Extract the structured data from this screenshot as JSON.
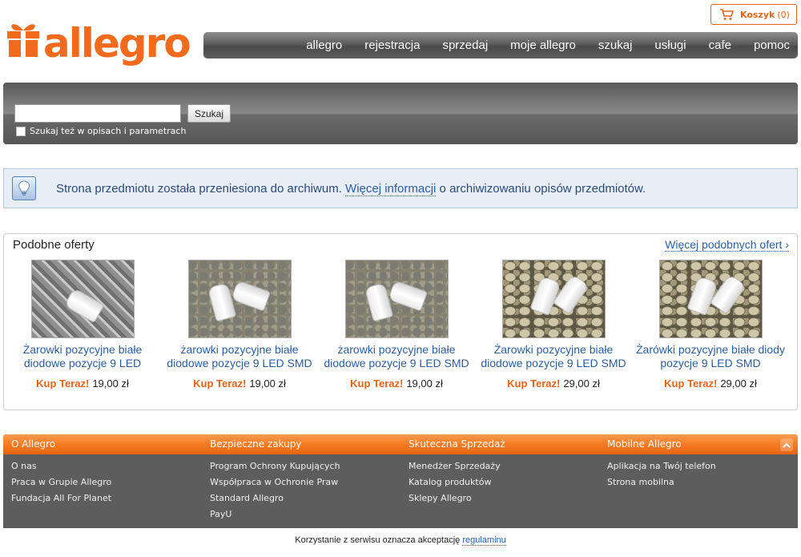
{
  "cart": {
    "label": "Koszyk",
    "count": "(0)"
  },
  "logo": {
    "text": "allegro"
  },
  "nav": {
    "items": [
      "allegro",
      "rejestracja",
      "sprzedaj",
      "moje allegro",
      "szukaj",
      "usługi",
      "cafe",
      "pomoc"
    ]
  },
  "search": {
    "value": "",
    "button": "Szukaj",
    "checkbox_label": "Szukaj też w opisach i parametrach"
  },
  "info": {
    "text_before": "Strona przedmiotu została przeniesiona do archiwum. ",
    "link": "Więcej informacji",
    "text_after": " o archiwizowaniu opisów przedmiotów."
  },
  "offers": {
    "title": "Podobne oferty",
    "more": "Więcej podobnych ofert ›",
    "buy_label": "Kup Teraz!",
    "items": [
      {
        "name": "Żarowki pozycyjne białe diodowe pozycje 9 LED",
        "price": "19,00 zł",
        "image": "metal"
      },
      {
        "name": "żarowki pozycyjne białe diodowe pozycje 9 LED SMD",
        "price": "19,00 zł",
        "image": "stone"
      },
      {
        "name": "żarowki pozycyjne białe diodowe pozycje 9 LED SMD",
        "price": "19,00 zł",
        "image": "stone"
      },
      {
        "name": "Żarowki pozycyjne białe diodowe pozycje 9 LED SMD",
        "price": "29,00 zł",
        "image": "pebble"
      },
      {
        "name": "Żarówki pozycyjne białe diody pozycje 9 LED SMD",
        "price": "29,00 zł",
        "image": "pebble"
      }
    ]
  },
  "footer": {
    "columns": [
      {
        "title": "O Allegro",
        "links": [
          "O nas",
          "Praca w Grupie Allegro",
          "Fundacja All For Planet"
        ]
      },
      {
        "title": "Bezpieczne zakupy",
        "links": [
          "Program Ochrony Kupujących",
          "Współpraca w Ochronie Praw",
          "Standard Allegro",
          "PayU"
        ]
      },
      {
        "title": "Skuteczna Sprzedaż",
        "links": [
          "Menedżer Sprzedaży",
          "Katalog produktów",
          "Sklepy Allegro"
        ]
      },
      {
        "title": "Mobilne Allegro",
        "links": [
          "Aplikacja na Twój telefon",
          "Strona mobilna"
        ]
      }
    ],
    "terms_text": "Korzystanie z serwisu oznacza akceptację ",
    "terms_link": "regulaminu"
  },
  "colors": {
    "brand": "#f26a1b",
    "link": "#2a5ea3",
    "nav_bg": "#5c5c5c"
  },
  "icons": [
    "cart-icon",
    "gift-logo-icon",
    "lightbulb-icon",
    "chevron-up-icon"
  ]
}
